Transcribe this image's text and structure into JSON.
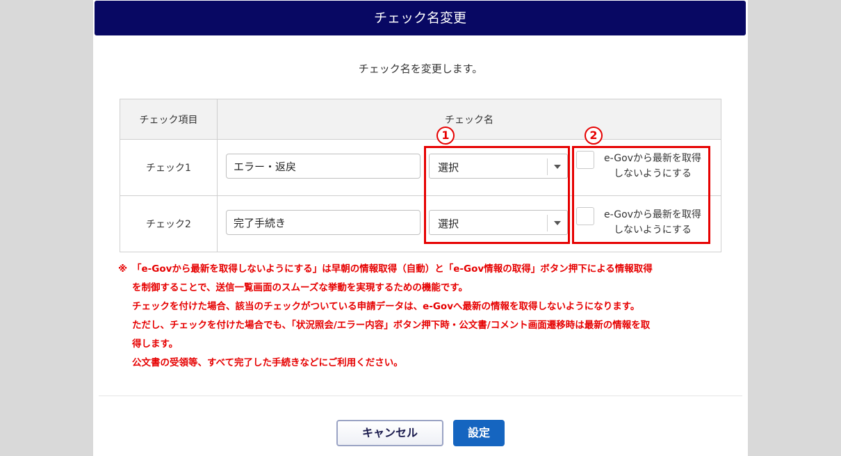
{
  "dialog": {
    "title": "チェック名変更",
    "message": "チェック名を変更します。"
  },
  "table": {
    "headers": {
      "item": "チェック項目",
      "name": "チェック名"
    },
    "rows": [
      {
        "item": "チェック1",
        "name_value": "エラー・返戻",
        "select_value": "選択",
        "checkbox_label_line1": "e-Govから最新を取得",
        "checkbox_label_line2": "しないようにする",
        "checked": false
      },
      {
        "item": "チェック2",
        "name_value": "完了手続き",
        "select_value": "選択",
        "checkbox_label_line1": "e-Govから最新を取得",
        "checkbox_label_line2": "しないようにする",
        "checked": false
      }
    ]
  },
  "annotations": {
    "badge1": "1",
    "badge2": "2",
    "color": "#e60000"
  },
  "notes": {
    "mark": "※",
    "lines": [
      "「e-Govから最新を取得しないようにする」は早朝の情報取得（自動）と「e-Gov情報の取得」ボタン押下による情報取得",
      "を制御することで、送信一覧画面のスムーズな挙動を実現するための機能です。",
      "チェックを付けた場合、該当のチェックがついている申請データは、e-Govへ最新の情報を取得しないようになります。",
      "ただし、チェックを付けた場合でも、「状況照会/エラー内容」ボタン押下時・公文書/コメント画面遷移時は最新の情報を取",
      "得します。",
      "公文書の受領等、すべて完了した手続きなどにご利用ください。"
    ]
  },
  "buttons": {
    "cancel": "キャンセル",
    "ok": "設定"
  },
  "colors": {
    "title_bar": "#080863",
    "primary_button": "#1565c0",
    "note_text": "#e60000"
  }
}
